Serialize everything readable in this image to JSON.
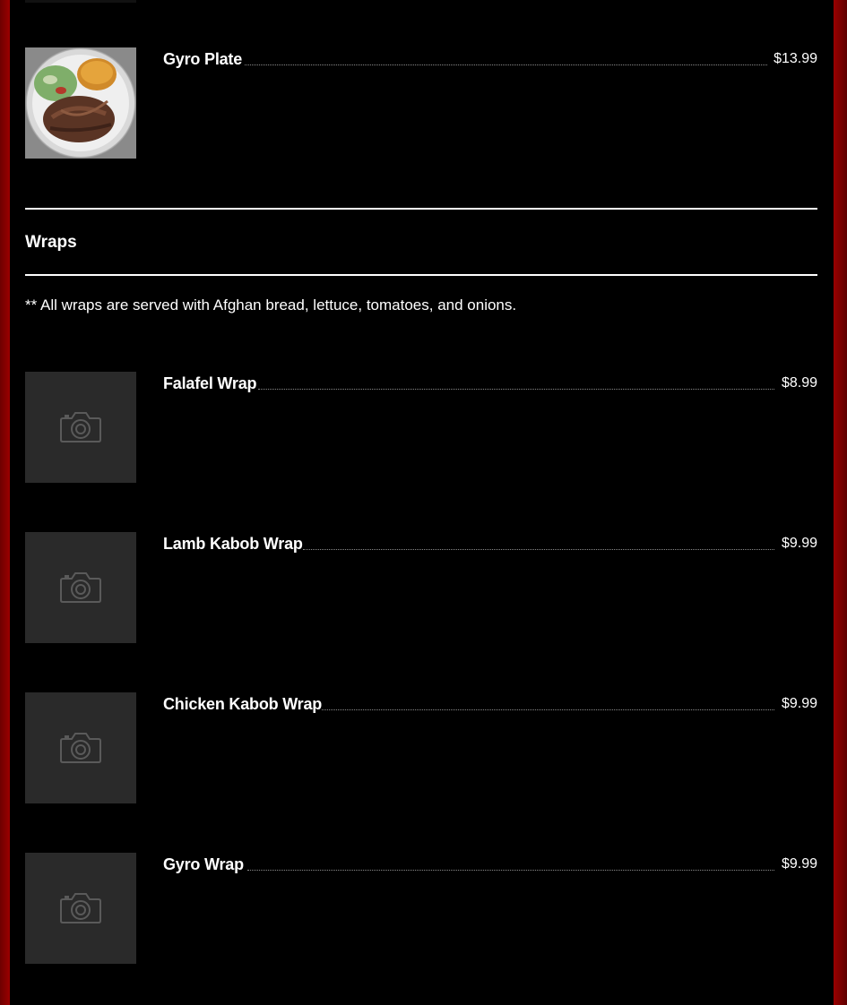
{
  "top_item": {
    "name": "Gyro Plate",
    "price": "$13.99",
    "image": "gyro-plate-photo"
  },
  "section": {
    "title": "Wraps",
    "note": "** All wraps are served with Afghan bread, lettuce, tomatoes, and onions."
  },
  "wraps": [
    {
      "name": "Falafel Wrap",
      "price": "$8.99",
      "image": "camera-placeholder-icon"
    },
    {
      "name": "Lamb Kabob Wrap",
      "price": "$9.99",
      "image": "camera-placeholder-icon"
    },
    {
      "name": "Chicken Kabob Wrap",
      "price": "$9.99",
      "image": "camera-placeholder-icon"
    },
    {
      "name": "Gyro Wrap",
      "price": "$9.99",
      "image": "camera-placeholder-icon"
    }
  ],
  "colors": {
    "background": "#000000",
    "frame": "#8b0000",
    "placeholder": "#2a2a2a",
    "text": "#ffffff"
  }
}
